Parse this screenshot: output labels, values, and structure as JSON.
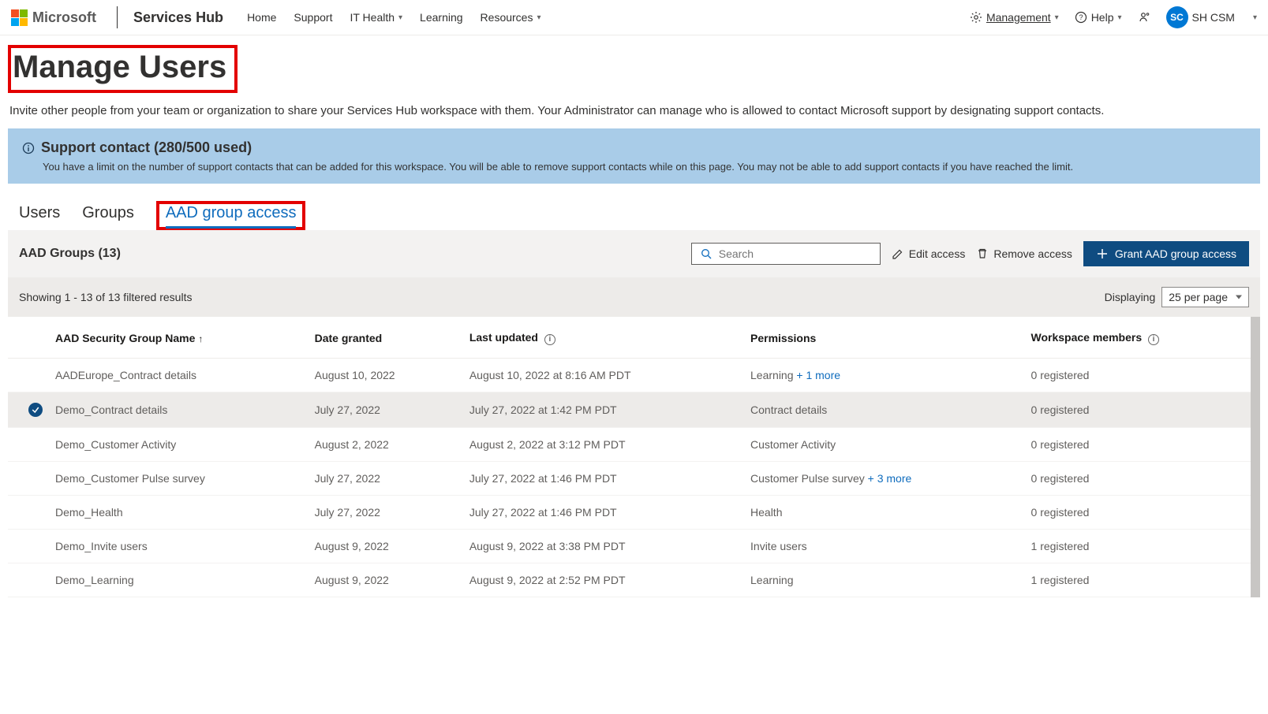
{
  "header": {
    "brand": "Microsoft",
    "hub": "Services Hub",
    "nav": [
      "Home",
      "Support",
      "IT Health",
      "Learning",
      "Resources"
    ],
    "management": "Management",
    "help": "Help",
    "userInitials": "SC",
    "userName": "SH CSM"
  },
  "page": {
    "title": "Manage Users",
    "desc": "Invite other people from your team or organization to share your Services Hub workspace with them. Your Administrator can manage who is allowed to contact Microsoft support by designating support contacts."
  },
  "banner": {
    "title": "Support contact (280/500 used)",
    "body": "You have a limit on the number of support contacts that can be added for this workspace. You will be able to remove support contacts while on this page. You may not be able to add support contacts if you have reached the limit."
  },
  "tabs": {
    "users": "Users",
    "groups": "Groups",
    "aad": "AAD group access"
  },
  "toolbar": {
    "title": "AAD Groups (13)",
    "searchPlaceholder": "Search",
    "edit": "Edit access",
    "remove": "Remove access",
    "grant": "Grant AAD group access"
  },
  "filter": {
    "showing": "Showing 1 - 13 of 13 filtered results",
    "displaying": "Displaying",
    "perPage": "25 per page"
  },
  "columns": {
    "name": "AAD Security Group Name",
    "date": "Date granted",
    "updated": "Last updated",
    "perm": "Permissions",
    "members": "Workspace members"
  },
  "rows": [
    {
      "selected": false,
      "name": "AADEurope_Contract details",
      "date": "August 10, 2022",
      "updated": "August 10, 2022 at 8:16 AM PDT",
      "perm": "Learning",
      "permMore": "+ 1 more",
      "members": "0 registered"
    },
    {
      "selected": true,
      "name": "Demo_Contract details",
      "date": "July 27, 2022",
      "updated": "July 27, 2022 at 1:42 PM PDT",
      "perm": "Contract details",
      "permMore": "",
      "members": "0 registered"
    },
    {
      "selected": false,
      "name": "Demo_Customer Activity",
      "date": "August 2, 2022",
      "updated": "August 2, 2022 at 3:12 PM PDT",
      "perm": "Customer Activity",
      "permMore": "",
      "members": "0 registered"
    },
    {
      "selected": false,
      "name": "Demo_Customer Pulse survey",
      "date": "July 27, 2022",
      "updated": "July 27, 2022 at 1:46 PM PDT",
      "perm": "Customer Pulse survey",
      "permMore": "+ 3 more",
      "members": "0 registered"
    },
    {
      "selected": false,
      "name": "Demo_Health",
      "date": "July 27, 2022",
      "updated": "July 27, 2022 at 1:46 PM PDT",
      "perm": "Health",
      "permMore": "",
      "members": "0 registered"
    },
    {
      "selected": false,
      "name": "Demo_Invite users",
      "date": "August 9, 2022",
      "updated": "August 9, 2022 at 3:38 PM PDT",
      "perm": "Invite users",
      "permMore": "",
      "members": "1 registered"
    },
    {
      "selected": false,
      "name": "Demo_Learning",
      "date": "August 9, 2022",
      "updated": "August 9, 2022 at 2:52 PM PDT",
      "perm": "Learning",
      "permMore": "",
      "members": "1 registered"
    }
  ]
}
